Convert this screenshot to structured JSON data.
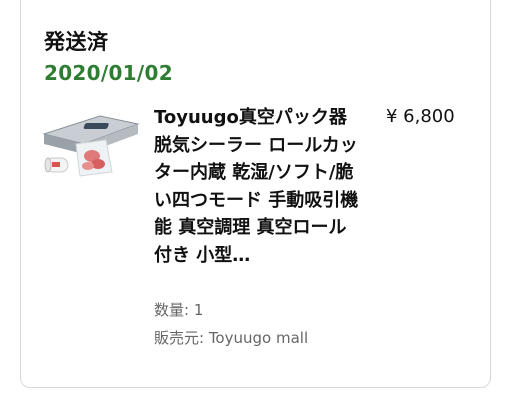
{
  "order": {
    "status": "発送済",
    "date": "2020/01/02"
  },
  "item": {
    "image_icon": "vacuum-sealer-product-photo",
    "title": "Toyuugo真空パック器 脱気シーラー ロールカッター内蔵 乾湿/ソフト/脆い四つモード 手動吸引機能 真空調理 真空ロール付き 小型…",
    "price": "¥ 6,800",
    "quantity": "数量: 1",
    "seller": "販売元: Toyuugo mall"
  },
  "colors": {
    "date_green": "#2e7d32",
    "text": "#111111",
    "muted": "#666666",
    "border": "#d5d9d9"
  }
}
